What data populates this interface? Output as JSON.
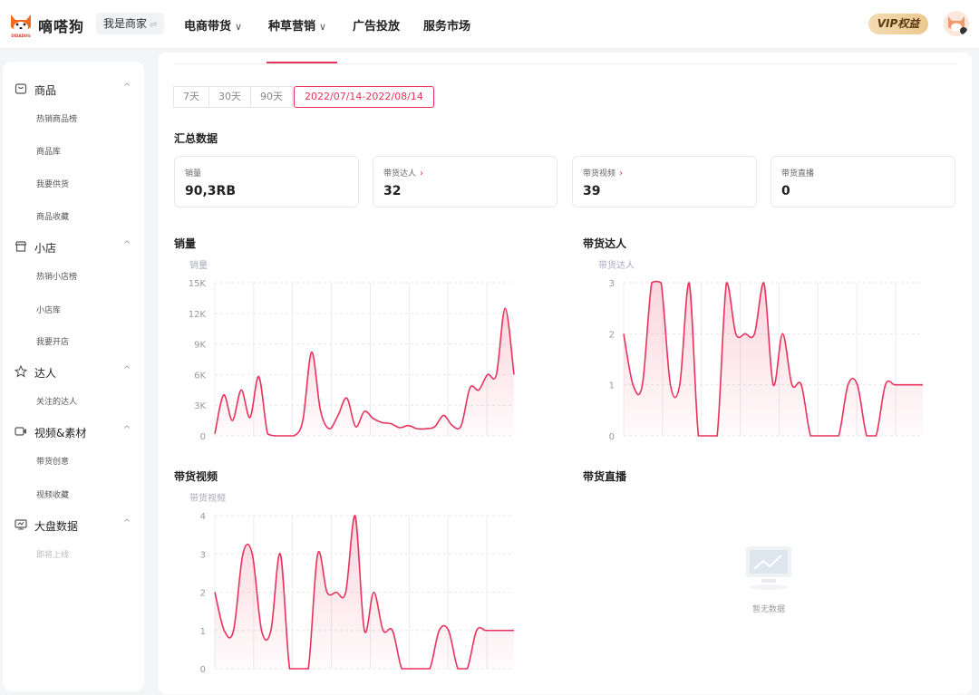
{
  "app": {
    "logo_text": "嘀嗒狗",
    "logo_sub": "DIDADOG",
    "role_label": "我是商家",
    "role_switch": "⇌"
  },
  "nav": [
    {
      "label": "电商带货",
      "chevron": "chevron-down"
    },
    {
      "label": "种草营销",
      "chevron": "chevron-down"
    },
    {
      "label": "广告投放"
    },
    {
      "label": "服务市场"
    }
  ],
  "vip_label": "VIP权益",
  "sidebar": {
    "groups": [
      {
        "icon": "product-icon",
        "label": "商品",
        "arrow": "^",
        "items": [
          "热销商品榜",
          "商品库",
          "我要供货",
          "商品收藏"
        ]
      },
      {
        "icon": "shop-icon",
        "label": "小店",
        "arrow": "^",
        "items": [
          "热销小店榜",
          "小店库",
          "我要开店"
        ]
      },
      {
        "icon": "star-person-icon",
        "label": "达人",
        "arrow": "^",
        "items": [
          "关注的达人"
        ]
      },
      {
        "icon": "video-icon",
        "label": "视频&素材",
        "arrow": "^",
        "items": [
          "带货创意",
          "视频收藏"
        ]
      },
      {
        "icon": "dashboard-icon",
        "label": "大盘数据",
        "arrow": "^",
        "items": [
          "即将上线"
        ]
      }
    ]
  },
  "date_ranges": [
    "7天",
    "30天",
    "90天",
    "2022/07/14-2022/08/14"
  ],
  "summary": {
    "title": "汇总数据",
    "cards": [
      {
        "label": "销量",
        "value": "90,3RB",
        "arrow": ""
      },
      {
        "label": "带货达人",
        "value": "32",
        "arrow": "›"
      },
      {
        "label": "带货视频",
        "value": "39",
        "arrow": "›"
      },
      {
        "label": "带货直播",
        "value": "0",
        "arrow": ""
      }
    ]
  },
  "chart_data": [
    {
      "type": "area",
      "title": "销量",
      "ylabel": "销量",
      "ylim": [
        0,
        15000
      ],
      "yticks": [
        "0",
        "3K",
        "6K",
        "9K",
        "12K",
        "15K"
      ],
      "values": [
        200,
        4000,
        1500,
        4500,
        1800,
        5800,
        200,
        0,
        0,
        0,
        1500,
        8200,
        2500,
        700,
        2000,
        3700,
        900,
        2400,
        1700,
        1300,
        1200,
        800,
        1000,
        700,
        700,
        900,
        2000,
        1000,
        1000,
        4700,
        4500,
        6000,
        6000,
        12500,
        6000
      ],
      "line_color": "#e8325c"
    },
    {
      "type": "area",
      "title": "带货达人",
      "ylabel": "带货达人",
      "ylim": [
        0,
        3
      ],
      "yticks": [
        "0",
        "1",
        "2",
        "3"
      ],
      "values": [
        2,
        1,
        1,
        3,
        3,
        1,
        1,
        3,
        0,
        0,
        0,
        3,
        2,
        2,
        2,
        3,
        1,
        2,
        1,
        1,
        0,
        0,
        0,
        0,
        1,
        1,
        0,
        0,
        1,
        1,
        1,
        1,
        1
      ],
      "line_color": "#e8325c"
    },
    {
      "type": "area",
      "title": "带货视频",
      "ylabel": "带货视频",
      "ylim": [
        0,
        4
      ],
      "yticks": [
        "0",
        "1",
        "2",
        "3",
        "4"
      ],
      "values": [
        2,
        1,
        1,
        3,
        3,
        1,
        1,
        3,
        0,
        0,
        0,
        3,
        2,
        2,
        2,
        4,
        1,
        2,
        1,
        1,
        0,
        0,
        0,
        0,
        1,
        1,
        0,
        0,
        1,
        1,
        1,
        1,
        1
      ],
      "line_color": "#e8325c"
    },
    {
      "type": "area",
      "title": "带货直播",
      "values": [],
      "empty_text": "暂无数据"
    }
  ]
}
